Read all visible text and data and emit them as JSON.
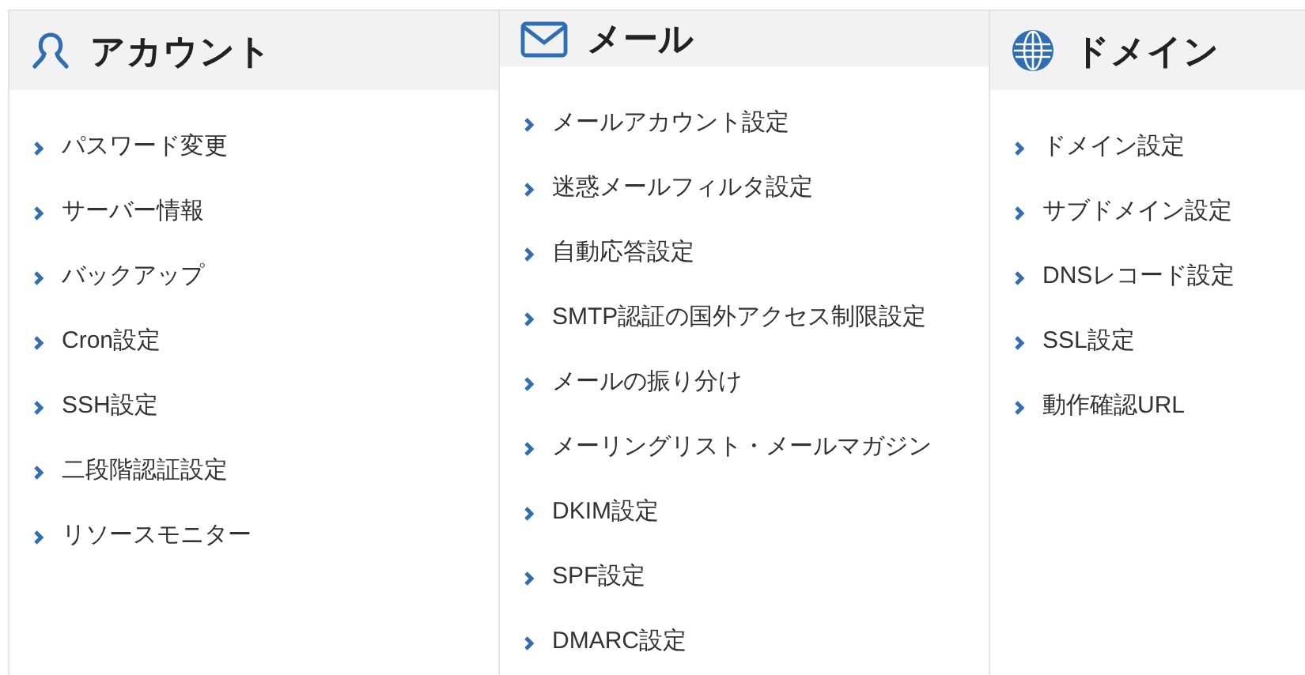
{
  "columns": [
    {
      "kind": "person",
      "title": "アカウント",
      "items": [
        "パスワード変更",
        "サーバー情報",
        "バックアップ",
        "Cron設定",
        "SSH設定",
        "二段階認証設定",
        "リソースモニター"
      ]
    },
    {
      "kind": "mail",
      "title": "メール",
      "items": [
        "メールアカウント設定",
        "迷惑メールフィルタ設定",
        "自動応答設定",
        "SMTP認証の国外アクセス制限設定",
        "メールの振り分け",
        "メーリングリスト・メールマガジン",
        "DKIM設定",
        "SPF設定",
        "DMARC設定"
      ]
    },
    {
      "kind": "globe",
      "title": "ドメイン",
      "items": [
        "ドメイン設定",
        "サブドメイン設定",
        "DNSレコード設定",
        "SSL設定",
        "動作確認URL"
      ]
    }
  ]
}
